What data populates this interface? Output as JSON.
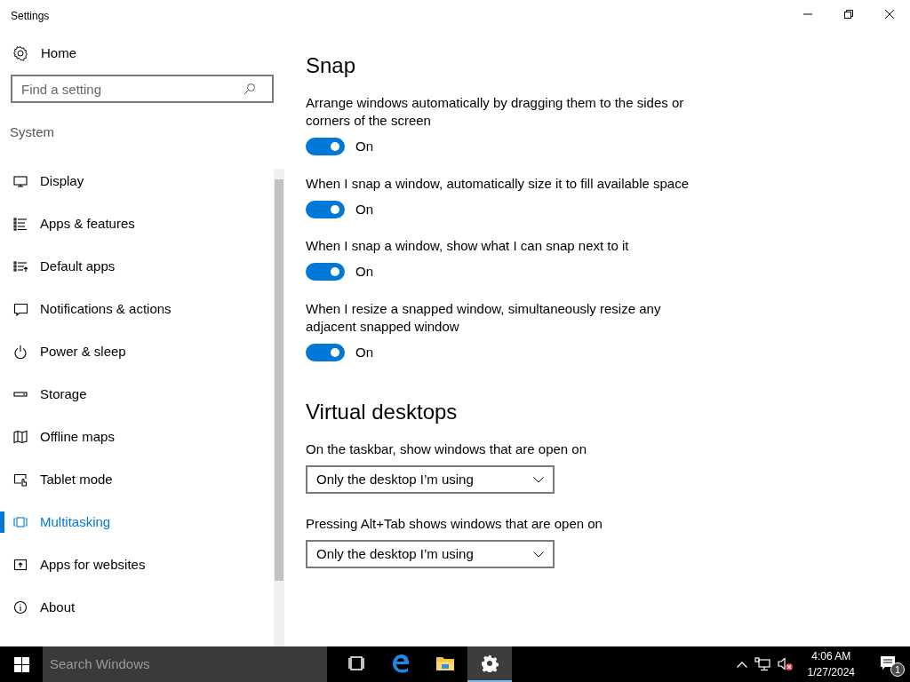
{
  "window": {
    "title": "Settings"
  },
  "sidebar": {
    "home": {
      "label": "Home"
    },
    "search": {
      "placeholder": "Find a setting"
    },
    "section": "System",
    "items": [
      {
        "label": "Display",
        "selected": false
      },
      {
        "label": "Apps & features",
        "selected": false
      },
      {
        "label": "Default apps",
        "selected": false
      },
      {
        "label": "Notifications & actions",
        "selected": false
      },
      {
        "label": "Power & sleep",
        "selected": false
      },
      {
        "label": "Storage",
        "selected": false
      },
      {
        "label": "Offline maps",
        "selected": false
      },
      {
        "label": "Tablet mode",
        "selected": false
      },
      {
        "label": "Multitasking",
        "selected": true
      },
      {
        "label": "Apps for websites",
        "selected": false
      },
      {
        "label": "About",
        "selected": false
      }
    ]
  },
  "content": {
    "sections": [
      {
        "title": "Snap",
        "toggles": [
          {
            "label": "Arrange windows automatically by dragging them to the sides or corners of the screen",
            "on": true,
            "state_text": "On"
          },
          {
            "label": "When I snap a window, automatically size it to fill available space",
            "on": true,
            "state_text": "On"
          },
          {
            "label": "When I snap a window, show what I can snap next to it",
            "on": true,
            "state_text": "On"
          },
          {
            "label": "When I resize a snapped window, simultaneously resize any adjacent snapped window",
            "on": true,
            "state_text": "On"
          }
        ]
      },
      {
        "title": "Virtual desktops",
        "dropdowns": [
          {
            "label": "On the taskbar, show windows that are open on",
            "value": "Only the desktop I’m using"
          },
          {
            "label": "Pressing Alt+Tab shows windows that are open on",
            "value": "Only the desktop I’m using"
          }
        ]
      }
    ]
  },
  "taskbar": {
    "search": {
      "placeholder": "Search Windows"
    },
    "apps": [
      {
        "kind": "taskview",
        "active": false
      },
      {
        "kind": "browser",
        "active": false
      },
      {
        "kind": "folder",
        "active": false
      },
      {
        "kind": "settings",
        "active": true
      }
    ],
    "clock": {
      "time": "4:06 AM",
      "date": "1/27/2024"
    },
    "notifications": {
      "count": "1"
    }
  }
}
